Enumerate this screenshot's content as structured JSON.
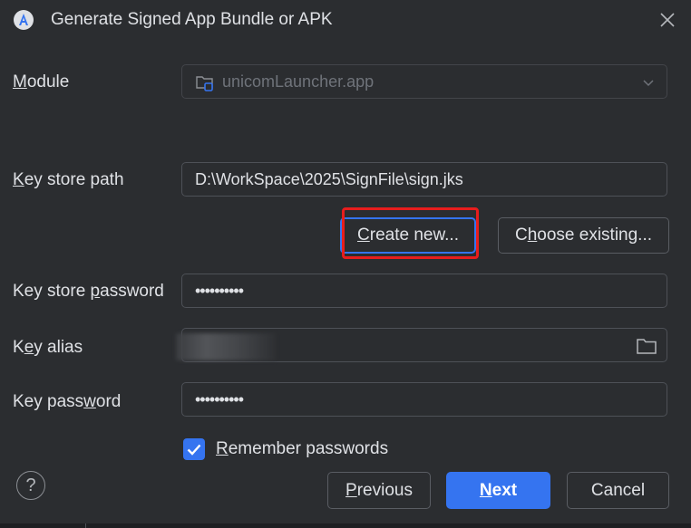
{
  "window": {
    "title": "Generate Signed App Bundle or APK",
    "app_icon": "android-studio-icon",
    "close_icon": "close-icon"
  },
  "module": {
    "label_pre": "",
    "label_mnemonic": "M",
    "label_post": "odule",
    "value": "unicomLauncher.app",
    "icon": "module-folder-icon"
  },
  "keystore": {
    "label_mnemonic": "K",
    "label_post": "ey store path",
    "value": "D:\\WorkSpace\\2025\\SignFile\\sign.jks",
    "create_new": {
      "pre": "",
      "mnemonic": "C",
      "post": "reate new..."
    },
    "choose_existing": {
      "pre": "C",
      "mnemonic": "h",
      "post": "oose existing..."
    }
  },
  "keystore_password": {
    "label_pre": "Key store ",
    "label_mnemonic": "p",
    "label_post": "assword",
    "value": "••••••••••"
  },
  "key_alias": {
    "label_pre": "K",
    "label_mnemonic": "e",
    "label_post": "y alias",
    "value": ""
  },
  "key_password": {
    "label_pre": "Key pass",
    "label_mnemonic": "w",
    "label_post": "ord",
    "value": "••••••••••"
  },
  "remember": {
    "checked": true,
    "label_mnemonic": "R",
    "label_post": "emember passwords"
  },
  "footer": {
    "help": "?",
    "previous": {
      "mnemonic": "P",
      "post": "revious"
    },
    "next": {
      "mnemonic": "N",
      "post": "ext"
    },
    "cancel": "Cancel"
  },
  "colors": {
    "accent": "#3574f0",
    "highlight": "#e81d1d",
    "background": "#2b2d30"
  }
}
